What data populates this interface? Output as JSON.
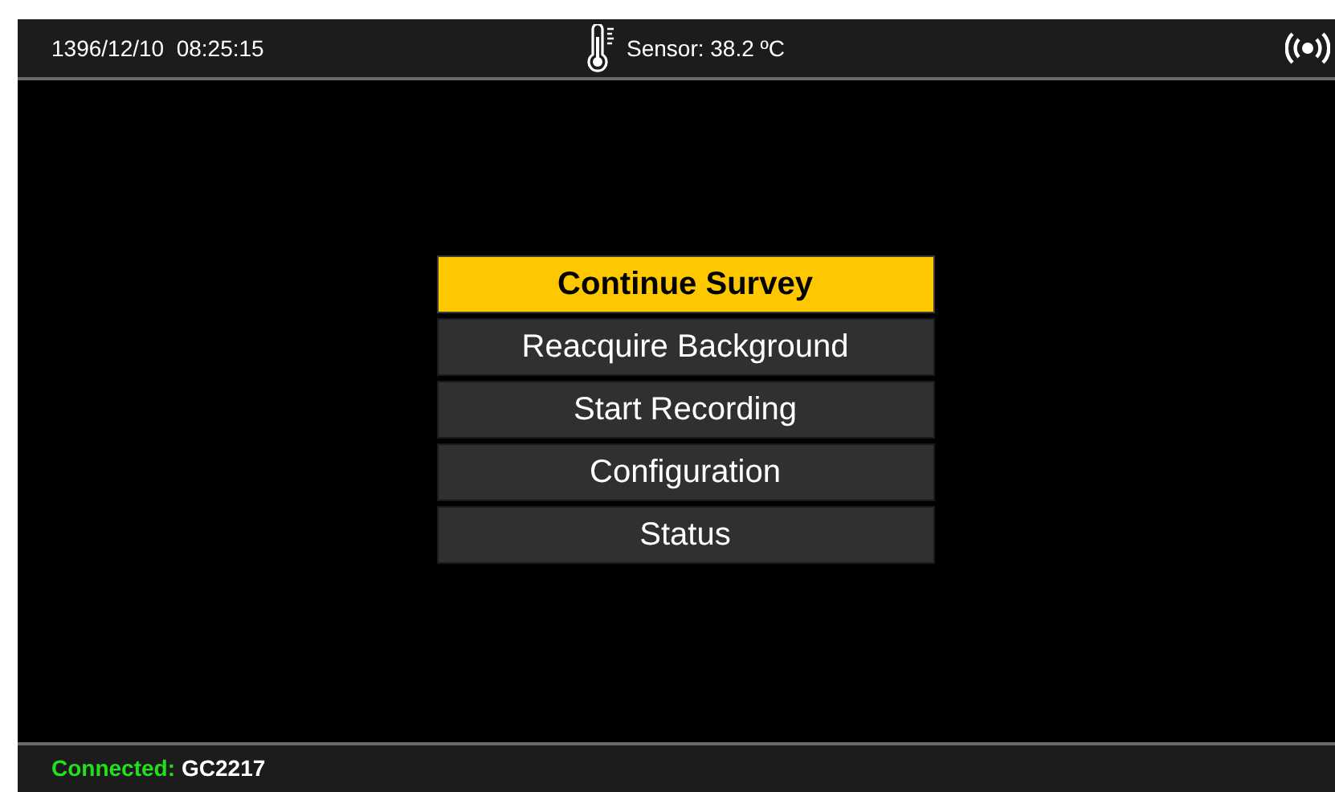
{
  "top_bar": {
    "datetime": "1396/12/10  08:25:15",
    "sensor": "Sensor: 38.2 ºC"
  },
  "menu": [
    {
      "label": "Continue Survey",
      "selected": true
    },
    {
      "label": "Reacquire Background",
      "selected": false
    },
    {
      "label": "Start Recording",
      "selected": false
    },
    {
      "label": "Configuration",
      "selected": false
    },
    {
      "label": "Status",
      "selected": false
    }
  ],
  "status_bar": {
    "label": "Connected:",
    "device": "GC2217"
  }
}
